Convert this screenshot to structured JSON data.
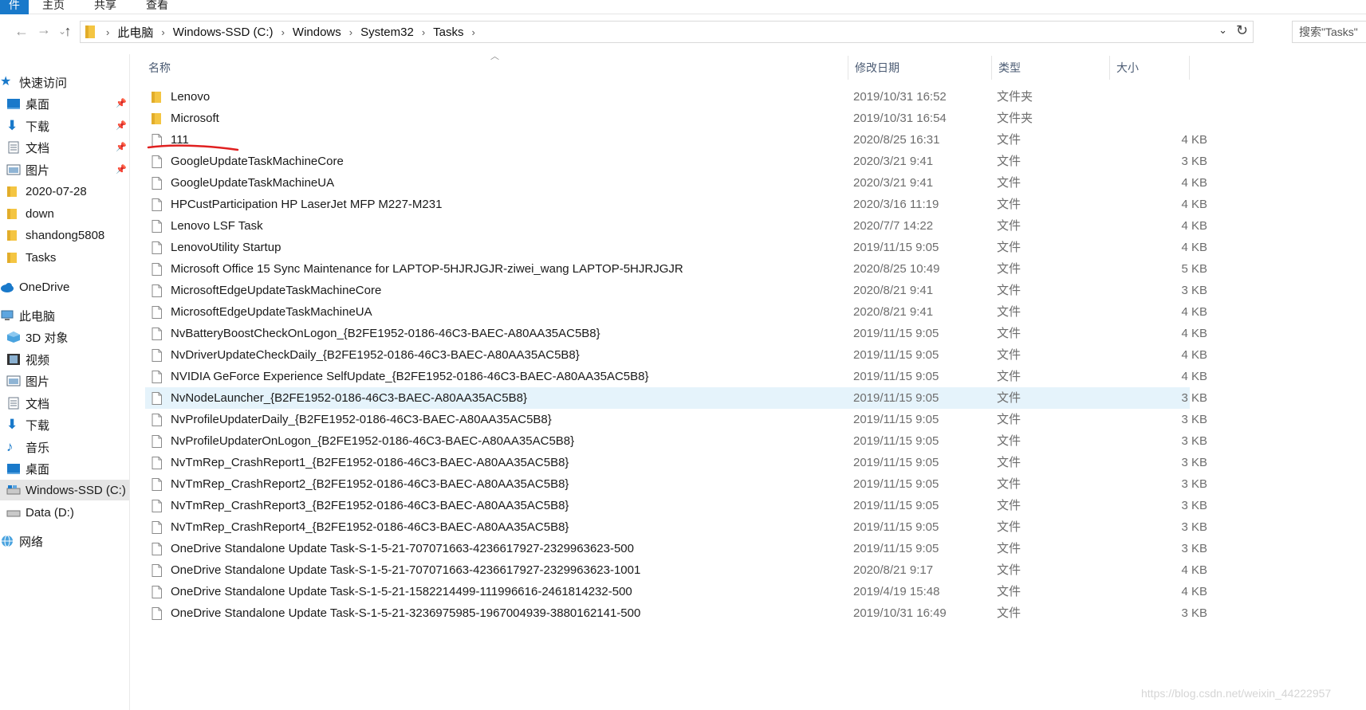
{
  "ribbon": {
    "tabs": [
      "件",
      "主页",
      "共享",
      "查看"
    ]
  },
  "address": {
    "crumbs": [
      "此电脑",
      "Windows-SSD (C:)",
      "Windows",
      "System32",
      "Tasks"
    ],
    "search_placeholder": "搜索\"Tasks\""
  },
  "nav": {
    "quick_access": "快速访问",
    "qa_items": [
      "桌面",
      "下载",
      "文档",
      "图片",
      "2020-07-28",
      "down",
      "shandong5808",
      "Tasks"
    ],
    "onedrive": "OneDrive",
    "this_pc": "此电脑",
    "pc_items": [
      "3D 对象",
      "视频",
      "图片",
      "文档",
      "下载",
      "音乐",
      "桌面",
      "Windows-SSD (C:)",
      "Data (D:)"
    ],
    "network": "网络"
  },
  "columns": {
    "name": "名称",
    "date": "修改日期",
    "type": "类型",
    "size": "大小"
  },
  "files": [
    {
      "name": "Lenovo",
      "date": "2019/10/31 16:52",
      "type": "文件夹",
      "size": "",
      "folder": true
    },
    {
      "name": "Microsoft",
      "date": "2019/10/31 16:54",
      "type": "文件夹",
      "size": "",
      "folder": true
    },
    {
      "name": "111",
      "date": "2020/8/25 16:31",
      "type": "文件",
      "size": "4 KB"
    },
    {
      "name": "GoogleUpdateTaskMachineCore",
      "date": "2020/3/21 9:41",
      "type": "文件",
      "size": "3 KB"
    },
    {
      "name": "GoogleUpdateTaskMachineUA",
      "date": "2020/3/21 9:41",
      "type": "文件",
      "size": "4 KB"
    },
    {
      "name": "HPCustParticipation HP LaserJet MFP M227-M231",
      "date": "2020/3/16 11:19",
      "type": "文件",
      "size": "4 KB"
    },
    {
      "name": "Lenovo LSF Task",
      "date": "2020/7/7 14:22",
      "type": "文件",
      "size": "4 KB"
    },
    {
      "name": "LenovoUtility Startup",
      "date": "2019/11/15 9:05",
      "type": "文件",
      "size": "4 KB"
    },
    {
      "name": "Microsoft Office 15 Sync Maintenance for LAPTOP-5HJRJGJR-ziwei_wang LAPTOP-5HJRJGJR",
      "date": "2020/8/25 10:49",
      "type": "文件",
      "size": "5 KB"
    },
    {
      "name": "MicrosoftEdgeUpdateTaskMachineCore",
      "date": "2020/8/21 9:41",
      "type": "文件",
      "size": "3 KB"
    },
    {
      "name": "MicrosoftEdgeUpdateTaskMachineUA",
      "date": "2020/8/21 9:41",
      "type": "文件",
      "size": "4 KB"
    },
    {
      "name": "NvBatteryBoostCheckOnLogon_{B2FE1952-0186-46C3-BAEC-A80AA35AC5B8}",
      "date": "2019/11/15 9:05",
      "type": "文件",
      "size": "4 KB"
    },
    {
      "name": "NvDriverUpdateCheckDaily_{B2FE1952-0186-46C3-BAEC-A80AA35AC5B8}",
      "date": "2019/11/15 9:05",
      "type": "文件",
      "size": "4 KB"
    },
    {
      "name": "NVIDIA GeForce Experience SelfUpdate_{B2FE1952-0186-46C3-BAEC-A80AA35AC5B8}",
      "date": "2019/11/15 9:05",
      "type": "文件",
      "size": "4 KB"
    },
    {
      "name": "NvNodeLauncher_{B2FE1952-0186-46C3-BAEC-A80AA35AC5B8}",
      "date": "2019/11/15 9:05",
      "type": "文件",
      "size": "3 KB",
      "highlight": true
    },
    {
      "name": "NvProfileUpdaterDaily_{B2FE1952-0186-46C3-BAEC-A80AA35AC5B8}",
      "date": "2019/11/15 9:05",
      "type": "文件",
      "size": "3 KB"
    },
    {
      "name": "NvProfileUpdaterOnLogon_{B2FE1952-0186-46C3-BAEC-A80AA35AC5B8}",
      "date": "2019/11/15 9:05",
      "type": "文件",
      "size": "3 KB"
    },
    {
      "name": "NvTmRep_CrashReport1_{B2FE1952-0186-46C3-BAEC-A80AA35AC5B8}",
      "date": "2019/11/15 9:05",
      "type": "文件",
      "size": "3 KB"
    },
    {
      "name": "NvTmRep_CrashReport2_{B2FE1952-0186-46C3-BAEC-A80AA35AC5B8}",
      "date": "2019/11/15 9:05",
      "type": "文件",
      "size": "3 KB"
    },
    {
      "name": "NvTmRep_CrashReport3_{B2FE1952-0186-46C3-BAEC-A80AA35AC5B8}",
      "date": "2019/11/15 9:05",
      "type": "文件",
      "size": "3 KB"
    },
    {
      "name": "NvTmRep_CrashReport4_{B2FE1952-0186-46C3-BAEC-A80AA35AC5B8}",
      "date": "2019/11/15 9:05",
      "type": "文件",
      "size": "3 KB"
    },
    {
      "name": "OneDrive Standalone Update Task-S-1-5-21-707071663-4236617927-2329963623-500",
      "date": "2019/11/15 9:05",
      "type": "文件",
      "size": "3 KB"
    },
    {
      "name": "OneDrive Standalone Update Task-S-1-5-21-707071663-4236617927-2329963623-1001",
      "date": "2020/8/21 9:17",
      "type": "文件",
      "size": "4 KB"
    },
    {
      "name": "OneDrive Standalone Update Task-S-1-5-21-1582214499-111996616-2461814232-500",
      "date": "2019/4/19 15:48",
      "type": "文件",
      "size": "4 KB"
    },
    {
      "name": "OneDrive Standalone Update Task-S-1-5-21-3236975985-1967004939-3880162141-500",
      "date": "2019/10/31 16:49",
      "type": "文件",
      "size": "3 KB"
    }
  ],
  "watermark": "https://blog.csdn.net/weixin_44222957",
  "colors": {
    "accent": "#1979ca",
    "folder": "#f4c542",
    "highlight_row": "#e5f3fb",
    "selected_nav": "#e5e5e5",
    "annotation": "#e02020"
  }
}
